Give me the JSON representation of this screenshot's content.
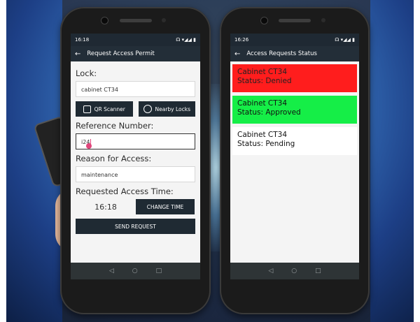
{
  "left_phone": {
    "status_time": "16:18",
    "title": "Request Access Permit",
    "lock_label": "Lock:",
    "lock_value": "cabinet CT34",
    "qr_button": "QR Scanner",
    "nearby_button": "Nearby Locks",
    "reference_label": "Reference Number:",
    "reference_value": "i24",
    "reason_label": "Reason for Access:",
    "reason_value": "maintenance",
    "time_label": "Requested Access Time:",
    "time_value": "16:18",
    "change_time_button": "CHANGE TIME",
    "send_button": "SEND REQUEST"
  },
  "right_phone": {
    "status_time": "16:26",
    "title": "Access Requests Status",
    "requests": [
      {
        "line1": "Cabinet CT34",
        "line2": "Status: Denied",
        "bg": "#ff1d1d",
        "fg": "#222222"
      },
      {
        "line1": "Cabinet CT34",
        "line2": "Status: Approved",
        "bg": "#15ee47",
        "fg": "#111111"
      },
      {
        "line1": "Cabinet CT34",
        "line2": "Status: Pending",
        "bg": "#ffffff",
        "fg": "#111111"
      }
    ]
  },
  "colors": {
    "appbar": "#232e38",
    "button": "#1f2a33",
    "accent": "#e0457b"
  }
}
